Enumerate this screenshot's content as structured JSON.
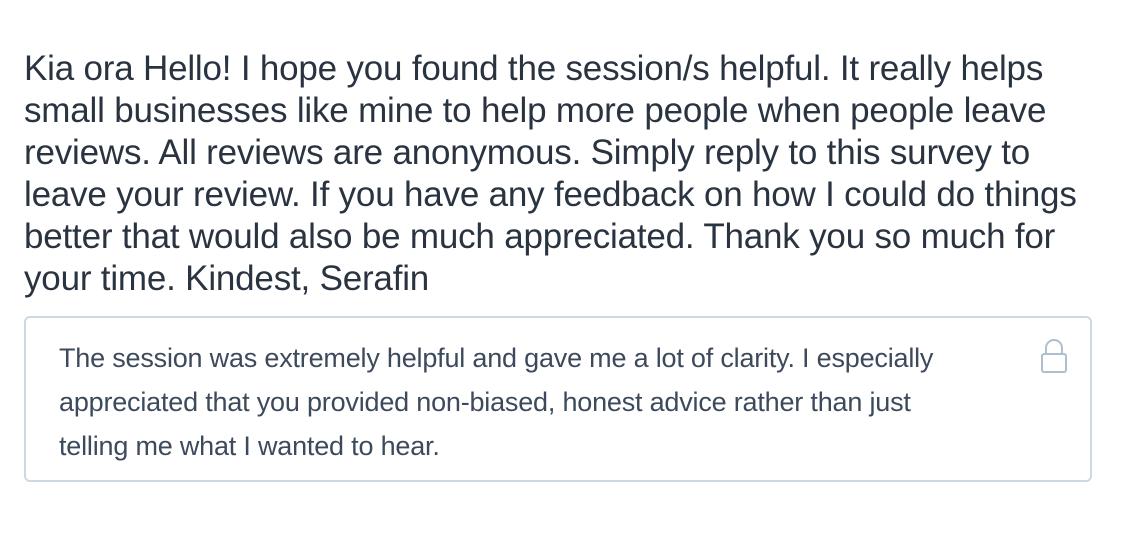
{
  "survey": {
    "question": "Kia ora Hello! I hope you found the session/s helpful. It really helps small businesses like mine to help more people when people leave reviews. All reviews are anonymous. Simply reply to this survey to leave your review. If you have any feedback on how I could do things better that would also be much appreciated. Thank you so much for your time. Kindest, Serafin",
    "answer": "The session was extremely helpful and gave me a lot of clarity. I especially appreciated that you provided non-biased, honest advice rather than just telling me what I wanted to hear.",
    "answer_locked": true,
    "icons": {
      "lock": "lock-icon"
    }
  },
  "colors": {
    "question_text": "#2a3340",
    "answer_text": "#3d4a5c",
    "answer_border": "#c9d9e6",
    "lock_icon": "#aebfcf"
  }
}
